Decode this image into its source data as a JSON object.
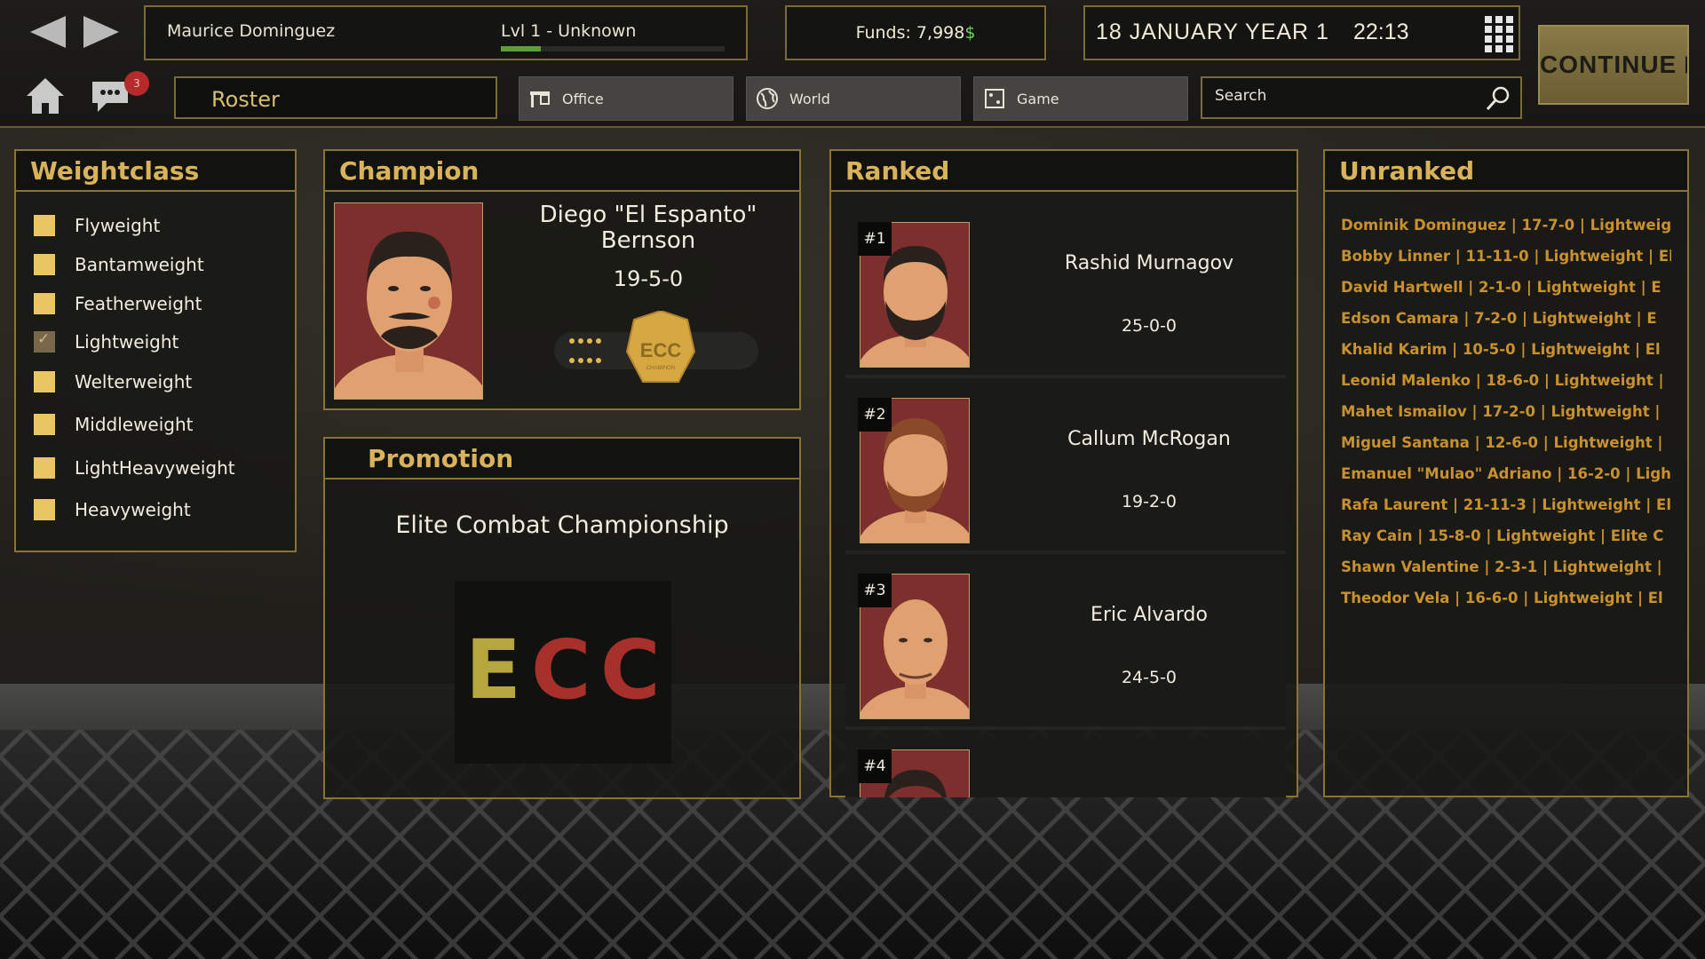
{
  "header": {
    "player_name": "Maurice Dominguez",
    "level": "Lvl 1 - Unknown",
    "xp_progress": 0.18,
    "funds_label": "Funds: 7,998",
    "funds_currency": "$",
    "date": "18 JANUARY YEAR 1",
    "time": "22:13",
    "continue_label": "CONTINUE",
    "notifications": "3"
  },
  "nav": {
    "roster": "Roster",
    "tabs": [
      {
        "label": "Office",
        "icon": "office-icon"
      },
      {
        "label": "World",
        "icon": "globe-icon"
      },
      {
        "label": "Game",
        "icon": "dice-icon"
      }
    ],
    "search_placeholder": "Search"
  },
  "weightclass": {
    "title": "Weightclass",
    "items": [
      {
        "label": "Flyweight",
        "checked": false
      },
      {
        "label": "Bantamweight",
        "checked": false
      },
      {
        "label": "Featherweight",
        "checked": false
      },
      {
        "label": "Lightweight",
        "checked": true
      },
      {
        "label": "Welterweight",
        "checked": false
      },
      {
        "label": "Middleweight",
        "checked": false
      },
      {
        "label": "LightHeavyweight",
        "checked": false
      },
      {
        "label": "Heavyweight",
        "checked": false
      }
    ]
  },
  "champion": {
    "title": "Champion",
    "name": "Diego \"El Espanto\" Bernson",
    "record": "19-5-0",
    "belt_text": "ECC",
    "belt_subtext": "CHAMPION"
  },
  "promotion": {
    "title": "Promotion",
    "name": "Elite Combat Championship",
    "logo_text": [
      "E",
      "C",
      "C"
    ],
    "logo_colors": [
      "#b5a63e",
      "#a8302a",
      "#a8302a"
    ]
  },
  "ranked": {
    "title": "Ranked",
    "fighters": [
      {
        "rank": "#1",
        "name": "Rashid Murnagov",
        "record": "25-0-0"
      },
      {
        "rank": "#2",
        "name": "Callum McRogan",
        "record": "19-2-0"
      },
      {
        "rank": "#3",
        "name": "Eric Alvardo",
        "record": "24-5-0"
      },
      {
        "rank": "#4",
        "name": "",
        "record": ""
      }
    ]
  },
  "unranked": {
    "title": "Unranked",
    "fighters": [
      "Dominik Dominguez  |  17-7-0  |  Lightweigl",
      "Bobby Linner  |  11-11-0  |  Lightweight  |  Eli",
      "David Hartwell  |  2-1-0  |  Lightweight  |  E",
      "Edson Camara  |  7-2-0  |  Lightweight  |  E",
      "Khalid Karim  |  10-5-0  |  Lightweight  |  El",
      "Leonid Malenko  |  18-6-0  |  Lightweight  |",
      "Mahet Ismailov  |  17-2-0  |  Lightweight  |",
      "Miguel Santana  |  12-6-0  |  Lightweight  |",
      "Emanuel \"Mulao\" Adriano  |  16-2-0  |  Ligh",
      "Rafa Laurent  |  21-11-3  |  Lightweight  |  El",
      "Ray Cain  |  15-8-0  |  Lightweight  |  Elite C",
      "Shawn Valentine  |  2-3-1  |  Lightweight  |",
      "Theodor Vela  |  16-6-0  |  Lightweight  |  El"
    ]
  }
}
